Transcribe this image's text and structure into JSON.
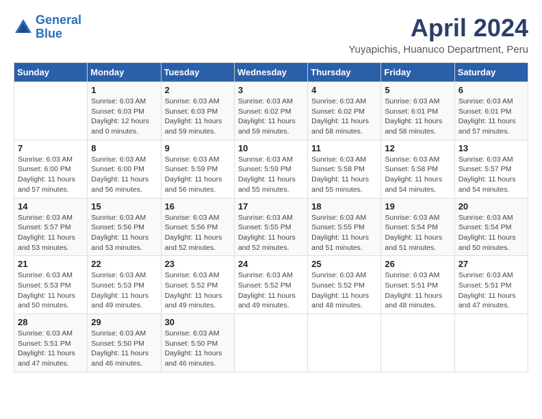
{
  "header": {
    "logo_line1": "General",
    "logo_line2": "Blue",
    "title": "April 2024",
    "subtitle": "Yuyapichis, Huanuco Department, Peru"
  },
  "days_of_week": [
    "Sunday",
    "Monday",
    "Tuesday",
    "Wednesday",
    "Thursday",
    "Friday",
    "Saturday"
  ],
  "weeks": [
    [
      {
        "day": "",
        "info": ""
      },
      {
        "day": "1",
        "info": "Sunrise: 6:03 AM\nSunset: 6:03 PM\nDaylight: 12 hours\nand 0 minutes."
      },
      {
        "day": "2",
        "info": "Sunrise: 6:03 AM\nSunset: 6:03 PM\nDaylight: 11 hours\nand 59 minutes."
      },
      {
        "day": "3",
        "info": "Sunrise: 6:03 AM\nSunset: 6:02 PM\nDaylight: 11 hours\nand 59 minutes."
      },
      {
        "day": "4",
        "info": "Sunrise: 6:03 AM\nSunset: 6:02 PM\nDaylight: 11 hours\nand 58 minutes."
      },
      {
        "day": "5",
        "info": "Sunrise: 6:03 AM\nSunset: 6:01 PM\nDaylight: 11 hours\nand 58 minutes."
      },
      {
        "day": "6",
        "info": "Sunrise: 6:03 AM\nSunset: 6:01 PM\nDaylight: 11 hours\nand 57 minutes."
      }
    ],
    [
      {
        "day": "7",
        "info": "Sunrise: 6:03 AM\nSunset: 6:00 PM\nDaylight: 11 hours\nand 57 minutes."
      },
      {
        "day": "8",
        "info": "Sunrise: 6:03 AM\nSunset: 6:00 PM\nDaylight: 11 hours\nand 56 minutes."
      },
      {
        "day": "9",
        "info": "Sunrise: 6:03 AM\nSunset: 5:59 PM\nDaylight: 11 hours\nand 56 minutes."
      },
      {
        "day": "10",
        "info": "Sunrise: 6:03 AM\nSunset: 5:59 PM\nDaylight: 11 hours\nand 55 minutes."
      },
      {
        "day": "11",
        "info": "Sunrise: 6:03 AM\nSunset: 5:58 PM\nDaylight: 11 hours\nand 55 minutes."
      },
      {
        "day": "12",
        "info": "Sunrise: 6:03 AM\nSunset: 5:58 PM\nDaylight: 11 hours\nand 54 minutes."
      },
      {
        "day": "13",
        "info": "Sunrise: 6:03 AM\nSunset: 5:57 PM\nDaylight: 11 hours\nand 54 minutes."
      }
    ],
    [
      {
        "day": "14",
        "info": "Sunrise: 6:03 AM\nSunset: 5:57 PM\nDaylight: 11 hours\nand 53 minutes."
      },
      {
        "day": "15",
        "info": "Sunrise: 6:03 AM\nSunset: 5:56 PM\nDaylight: 11 hours\nand 53 minutes."
      },
      {
        "day": "16",
        "info": "Sunrise: 6:03 AM\nSunset: 5:56 PM\nDaylight: 11 hours\nand 52 minutes."
      },
      {
        "day": "17",
        "info": "Sunrise: 6:03 AM\nSunset: 5:55 PM\nDaylight: 11 hours\nand 52 minutes."
      },
      {
        "day": "18",
        "info": "Sunrise: 6:03 AM\nSunset: 5:55 PM\nDaylight: 11 hours\nand 51 minutes."
      },
      {
        "day": "19",
        "info": "Sunrise: 6:03 AM\nSunset: 5:54 PM\nDaylight: 11 hours\nand 51 minutes."
      },
      {
        "day": "20",
        "info": "Sunrise: 6:03 AM\nSunset: 5:54 PM\nDaylight: 11 hours\nand 50 minutes."
      }
    ],
    [
      {
        "day": "21",
        "info": "Sunrise: 6:03 AM\nSunset: 5:53 PM\nDaylight: 11 hours\nand 50 minutes."
      },
      {
        "day": "22",
        "info": "Sunrise: 6:03 AM\nSunset: 5:53 PM\nDaylight: 11 hours\nand 49 minutes."
      },
      {
        "day": "23",
        "info": "Sunrise: 6:03 AM\nSunset: 5:52 PM\nDaylight: 11 hours\nand 49 minutes."
      },
      {
        "day": "24",
        "info": "Sunrise: 6:03 AM\nSunset: 5:52 PM\nDaylight: 11 hours\nand 49 minutes."
      },
      {
        "day": "25",
        "info": "Sunrise: 6:03 AM\nSunset: 5:52 PM\nDaylight: 11 hours\nand 48 minutes."
      },
      {
        "day": "26",
        "info": "Sunrise: 6:03 AM\nSunset: 5:51 PM\nDaylight: 11 hours\nand 48 minutes."
      },
      {
        "day": "27",
        "info": "Sunrise: 6:03 AM\nSunset: 5:51 PM\nDaylight: 11 hours\nand 47 minutes."
      }
    ],
    [
      {
        "day": "28",
        "info": "Sunrise: 6:03 AM\nSunset: 5:51 PM\nDaylight: 11 hours\nand 47 minutes."
      },
      {
        "day": "29",
        "info": "Sunrise: 6:03 AM\nSunset: 5:50 PM\nDaylight: 11 hours\nand 46 minutes."
      },
      {
        "day": "30",
        "info": "Sunrise: 6:03 AM\nSunset: 5:50 PM\nDaylight: 11 hours\nand 46 minutes."
      },
      {
        "day": "",
        "info": ""
      },
      {
        "day": "",
        "info": ""
      },
      {
        "day": "",
        "info": ""
      },
      {
        "day": "",
        "info": ""
      }
    ]
  ]
}
